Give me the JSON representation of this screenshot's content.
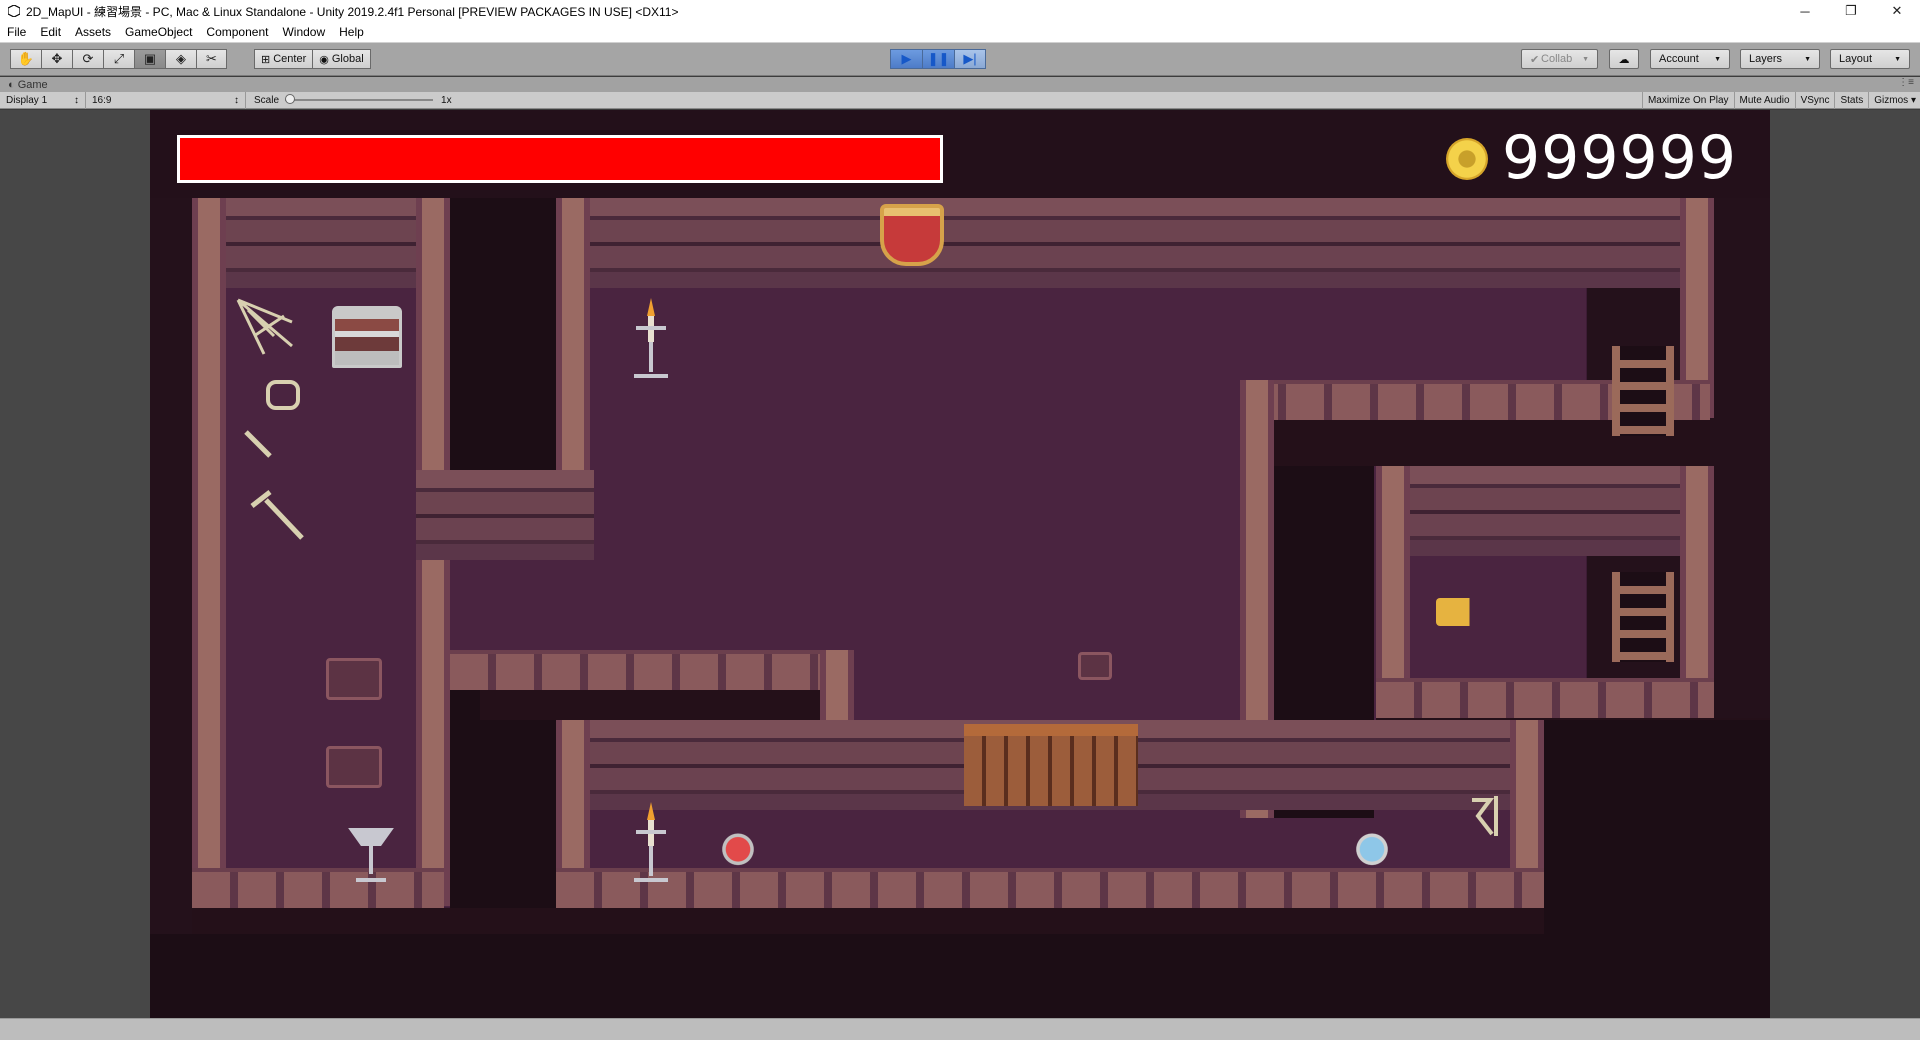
{
  "window": {
    "title": "2D_MapUI - 練習場景 - PC, Mac & Linux Standalone - Unity 2019.2.4f1 Personal [PREVIEW PACKAGES IN USE] <DX11>",
    "controls": {
      "minimize": "─",
      "restore": "❐",
      "close": "✕"
    }
  },
  "menubar": {
    "items": [
      "File",
      "Edit",
      "Assets",
      "GameObject",
      "Component",
      "Window",
      "Help"
    ]
  },
  "toolbar": {
    "tools": [
      {
        "name": "hand-tool",
        "glyph": "✋"
      },
      {
        "name": "move-tool",
        "glyph": "✥"
      },
      {
        "name": "rotate-tool",
        "glyph": "⟳"
      },
      {
        "name": "scale-tool",
        "glyph": "⤢"
      },
      {
        "name": "rect-tool",
        "glyph": "▣"
      },
      {
        "name": "transform-tool",
        "glyph": "◈"
      },
      {
        "name": "custom-tool",
        "glyph": "✂"
      }
    ],
    "pivot_label": "Center",
    "space_label": "Global",
    "play_glyph": "▶",
    "pause_glyph": "❚❚",
    "step_glyph": "▶|",
    "collab_label": "Collab",
    "account_label": "Account",
    "layers_label": "Layers",
    "layout_label": "Layout"
  },
  "tab": {
    "label": "Game"
  },
  "gamebar": {
    "display": "Display 1",
    "aspect": "16:9",
    "scale_label": "Scale",
    "scale_value": "1x",
    "maximize": "Maximize On Play",
    "mute": "Mute Audio",
    "vsync": "VSync",
    "stats": "Stats",
    "gizmos": "Gizmos"
  },
  "hud": {
    "coin_count": "999999",
    "health_fraction": 1.0,
    "colors": {
      "health": "#ff0000",
      "coin": "#f4d24a"
    }
  }
}
